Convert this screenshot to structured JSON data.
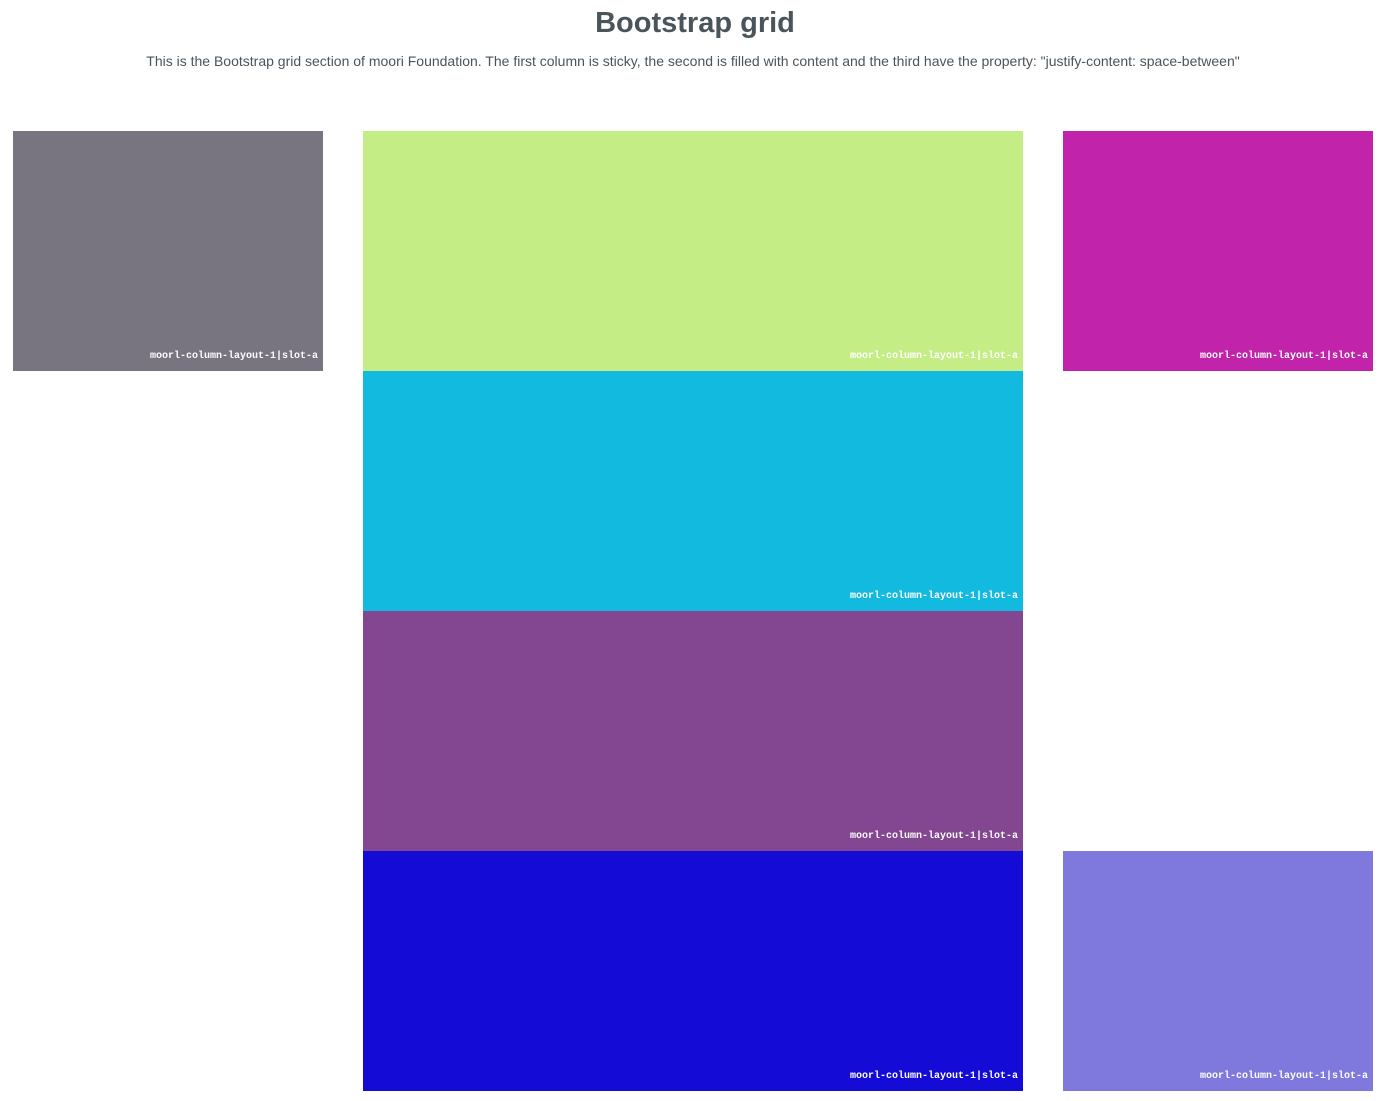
{
  "header": {
    "title": "Bootstrap grid",
    "description": "This is the Bootstrap grid section of moori Foundation. The first column is sticky, the second is filled with content and the third have the property: \"justify-content: space-between\""
  },
  "columns": {
    "left": {
      "tiles": [
        {
          "label": "moorl-column-layout-1|slot-a",
          "color": "#797580"
        }
      ]
    },
    "center": {
      "tiles": [
        {
          "label": "moorl-column-layout-1|slot-a",
          "color": "#c4ed86"
        },
        {
          "label": "moorl-column-layout-1|slot-a",
          "color": "#12bae0"
        },
        {
          "label": "moorl-column-layout-1|slot-a",
          "color": "#834690"
        },
        {
          "label": "moorl-column-layout-1|slot-a",
          "color": "#140cd6"
        }
      ]
    },
    "right": {
      "tiles": [
        {
          "label": "moorl-column-layout-1|slot-a",
          "color": "#c123ab"
        },
        {
          "label": "moorl-column-layout-1|slot-a",
          "color": "#7f79de"
        }
      ]
    }
  }
}
